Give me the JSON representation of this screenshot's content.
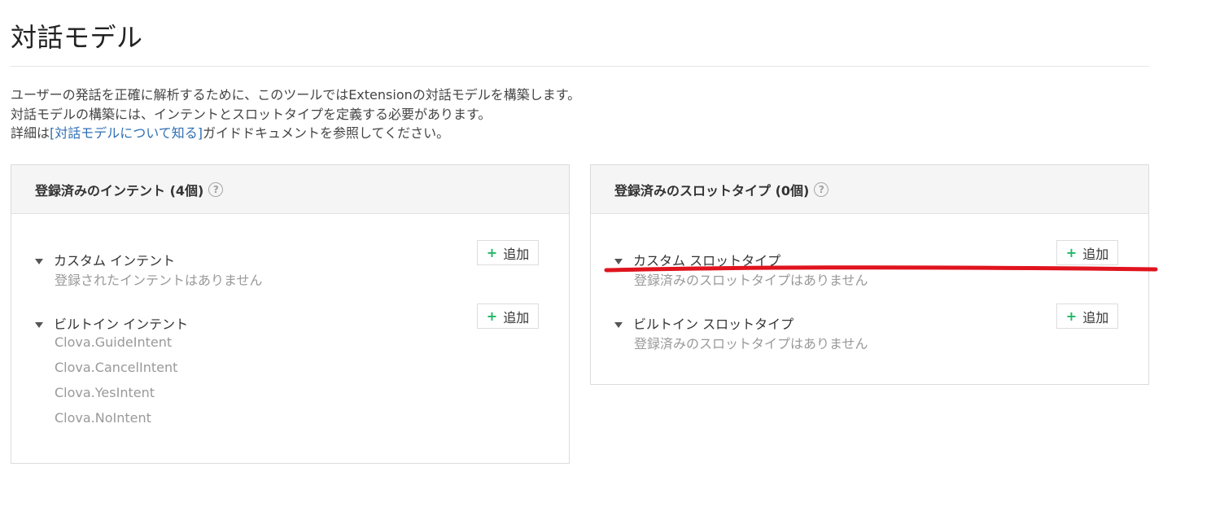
{
  "page": {
    "title": "対話モデル",
    "description_line1": "ユーザーの発話を正確に解析するために、このツールではExtensionの対話モデルを構築します。",
    "description_line2": "対話モデルの構築には、インテントとスロットタイプを定義する必要があります。",
    "description_line3_prefix": "詳細は",
    "description_link": "[対話モデルについて知る]",
    "description_line3_suffix": "ガイドドキュメントを参照してください。"
  },
  "intents_panel": {
    "title": "登録済みのインテント (4個)",
    "help_icon": "?",
    "custom": {
      "title": "カスタム インテント",
      "add_label": "追加",
      "empty_message": "登録されたインテントはありません"
    },
    "builtin": {
      "title": "ビルトイン インテント",
      "add_label": "追加",
      "items": [
        "Clova.GuideIntent",
        "Clova.CancelIntent",
        "Clova.YesIntent",
        "Clova.NoIntent"
      ]
    }
  },
  "slots_panel": {
    "title": "登録済みのスロットタイプ (0個)",
    "help_icon": "?",
    "custom": {
      "title": "カスタム スロットタイプ",
      "add_label": "追加",
      "empty_message": "登録済みのスロットタイプはありません"
    },
    "builtin": {
      "title": "ビルトイン スロットタイプ",
      "add_label": "追加",
      "empty_message": "登録済みのスロットタイプはありません"
    }
  },
  "icons": {
    "plus": "+",
    "expand": "triangle-down-icon",
    "help": "question-circle-icon"
  },
  "colors": {
    "accent_plus": "#1fb864",
    "link": "#2f6fb3",
    "annotation": "#e0141e"
  }
}
